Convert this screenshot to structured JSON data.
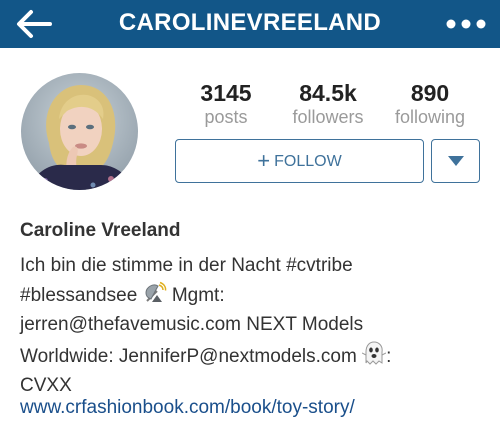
{
  "header": {
    "title": "CAROLINEVREELAND",
    "back_icon": "arrow-left-icon",
    "more_icon": "more-dots-icon",
    "background": "#125688"
  },
  "profile": {
    "avatar_icon": "profile-photo",
    "stats": [
      {
        "value": "3145",
        "label": "posts"
      },
      {
        "value": "84.5k",
        "label": "followers"
      },
      {
        "value": "890",
        "label": "following"
      }
    ],
    "follow_label": "FOLLOW",
    "follow_icon": "plus-icon",
    "dropdown_icon": "caret-down-icon",
    "accent": "#3f729b"
  },
  "bio": {
    "name": "Caroline Vreeland",
    "line1": "Ich bin die stimme in der Nacht #cvtribe",
    "line2a": "#blessandsee ",
    "line2b": " Mgmt:",
    "line3": "jerren@thefavemusic.com NEXT Models",
    "line4a": "Worldwide: JenniferP@nextmodels.com ",
    "line4b": ":",
    "line5": "CVXX",
    "satellite_icon": "satellite-dish-emoji",
    "ghost_icon": "ghost-emoji",
    "website": "www.crfashionbook.com/book/toy-story/"
  }
}
